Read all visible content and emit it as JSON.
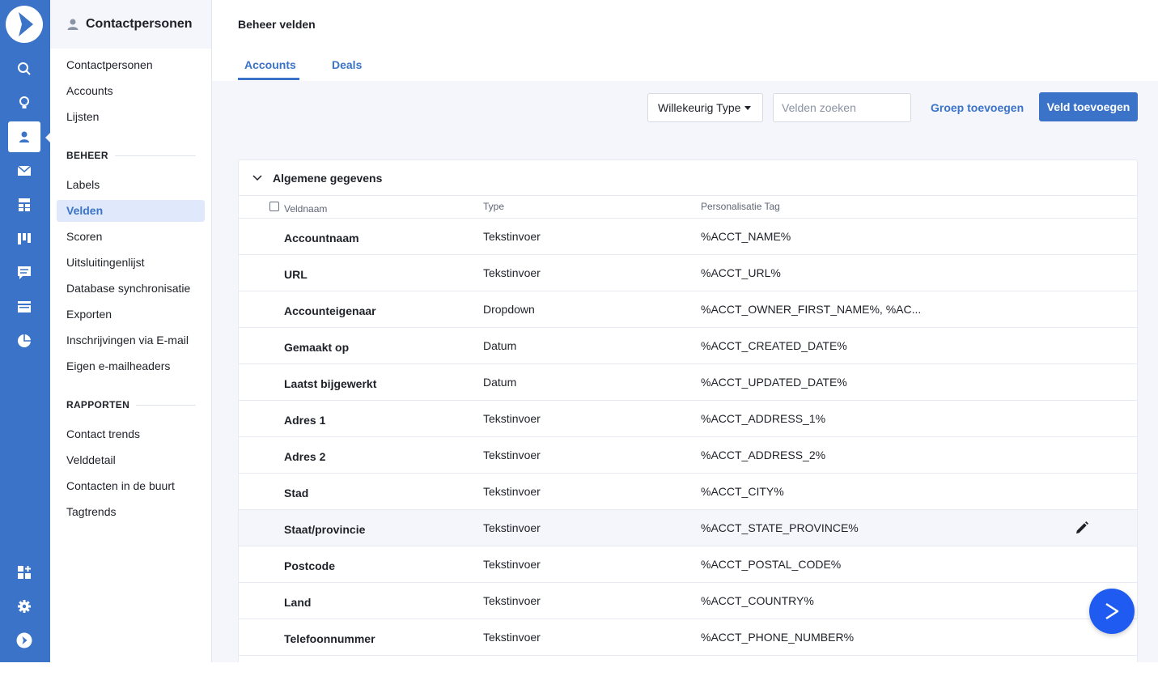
{
  "colors": {
    "rail": "#3a73c7",
    "accent": "#3a73c7",
    "fab": "#1f5bf0",
    "arrow": "#f02b1d"
  },
  "rail": {
    "icons": [
      "logo-icon",
      "search-icon",
      "lightbulb-icon",
      "contacts-icon",
      "mail-icon",
      "automation-icon",
      "deals-board-icon",
      "conversations-icon",
      "website-icon",
      "reports-icon",
      "apps-icon",
      "gear-icon",
      "activecampaign-icon"
    ]
  },
  "sidebar": {
    "title": "Contactpersonen",
    "top_items": [
      "Contactpersonen",
      "Accounts",
      "Lijsten"
    ],
    "section_beheer": "BEHEER",
    "beheer_items": [
      "Labels",
      "Velden",
      "Scoren",
      "Uitsluitingenlijst",
      "Database synchronisatie",
      "Exporten",
      "Inschrijvingen via E-mail",
      "Eigen e-mailheaders"
    ],
    "section_rapporten": "RAPPORTEN",
    "rapporten_items": [
      "Contact trends",
      "Velddetail",
      "Contacten in de buurt",
      "Tagtrends"
    ]
  },
  "header": {
    "title": "Beheer velden",
    "tabs": [
      "Accounts",
      "Deals"
    ]
  },
  "toolbar": {
    "type_filter": "Willekeurig Type",
    "search_placeholder": "Velden zoeken",
    "add_group": "Groep toevoegen",
    "add_field": "Veld toevoegen"
  },
  "table": {
    "group_title": "Algemene gegevens",
    "columns": [
      "Veldnaam",
      "Type",
      "Personalisatie Tag"
    ],
    "rows": [
      {
        "name": "Accountnaam",
        "type": "Tekstinvoer",
        "tag": "%ACCT_NAME%"
      },
      {
        "name": "URL",
        "type": "Tekstinvoer",
        "tag": "%ACCT_URL%"
      },
      {
        "name": "Accounteigenaar",
        "type": "Dropdown",
        "tag": "%ACCT_OWNER_FIRST_NAME%, %AC..."
      },
      {
        "name": "Gemaakt op",
        "type": "Datum",
        "tag": "%ACCT_CREATED_DATE%"
      },
      {
        "name": "Laatst bijgewerkt",
        "type": "Datum",
        "tag": "%ACCT_UPDATED_DATE%"
      },
      {
        "name": "Adres 1",
        "type": "Tekstinvoer",
        "tag": "%ACCT_ADDRESS_1%"
      },
      {
        "name": "Adres 2",
        "type": "Tekstinvoer",
        "tag": "%ACCT_ADDRESS_2%"
      },
      {
        "name": "Stad",
        "type": "Tekstinvoer",
        "tag": "%ACCT_CITY%"
      },
      {
        "name": "Staat/provincie",
        "type": "Tekstinvoer",
        "tag": "%ACCT_STATE_PROVINCE%"
      },
      {
        "name": "Postcode",
        "type": "Tekstinvoer",
        "tag": "%ACCT_POSTAL_CODE%"
      },
      {
        "name": "Land",
        "type": "Tekstinvoer",
        "tag": "%ACCT_COUNTRY%"
      },
      {
        "name": "Telefoonnummer",
        "type": "Tekstinvoer",
        "tag": "%ACCT_PHONE_NUMBER%"
      }
    ]
  }
}
